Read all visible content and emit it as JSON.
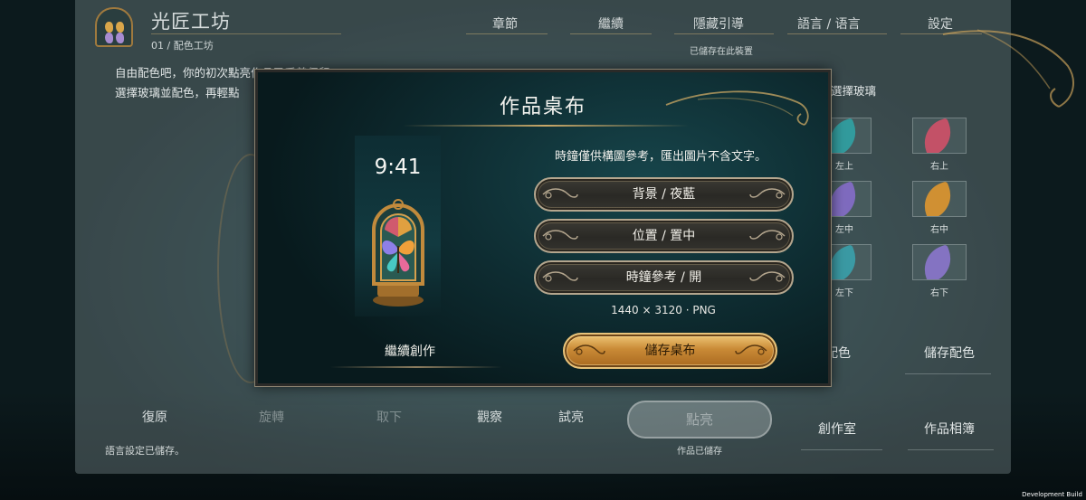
{
  "app": {
    "title": "光匠工坊",
    "subtitle": "01 / 配色工坊"
  },
  "top_nav": [
    "章節",
    "繼續",
    "隱藏引導",
    "語言 / 语言",
    "設定"
  ],
  "saved_on_device": "已儲存在此裝置",
  "intro_lines": [
    "自由配色吧，你的初次點亮作品已妥善保留。",
    "選擇玻璃並配色，再輕點"
  ],
  "right_panel": {
    "title": "選擇玻璃",
    "swatches": [
      {
        "label": "左上",
        "color": "#2fa7a8"
      },
      {
        "label": "右上",
        "color": "#d9506a"
      },
      {
        "label": "左中",
        "color": "#8a6fd0"
      },
      {
        "label": "右中",
        "color": "#e99a2c"
      },
      {
        "label": "左下",
        "color": "#3aa5b0"
      },
      {
        "label": "右下",
        "color": "#8f78d4"
      }
    ],
    "color_button_partial": "配色",
    "save_colors": "儲存配色"
  },
  "bottom_bar": {
    "reset": "復原",
    "rotate": "旋轉",
    "remove": "取下",
    "observe": "觀察",
    "try_light": "試亮",
    "light_up": "點亮",
    "studio": "創作室",
    "album": "作品相簿",
    "work_saved": "作品已儲存",
    "language_saved": "語言設定已儲存。"
  },
  "modal": {
    "title": "作品桌布",
    "preview_clock": "9:41",
    "hint": "時鐘僅供構圖參考，匯出圖片不含文字。",
    "options": [
      "背景 / 夜藍",
      "位置 / 置中",
      "時鐘參考 / 開"
    ],
    "spec": "1440 × 3120 · PNG",
    "continue_label": "繼續創作",
    "save_label": "儲存桌布"
  },
  "dev_build": "Development Build",
  "colors": {
    "accent_gold": "#e8c37a",
    "modal_bg": "#0e2c31",
    "petal_pink": "#e86a9a",
    "petal_orange": "#f0a03a",
    "petal_purple": "#8e7fe8",
    "petal_teal": "#48c9c4"
  }
}
